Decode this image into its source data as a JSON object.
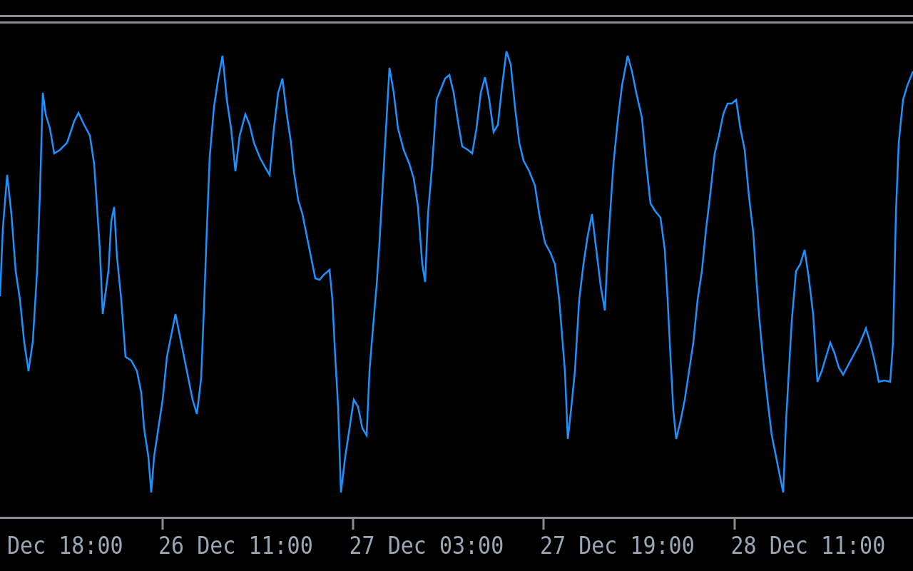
{
  "time_axis": {
    "labels": [
      "Dec 18:00",
      "26 Dec 11:00",
      "27 Dec 03:00",
      "27 Dec 19:00",
      "28 Dec 11:00"
    ]
  }
}
